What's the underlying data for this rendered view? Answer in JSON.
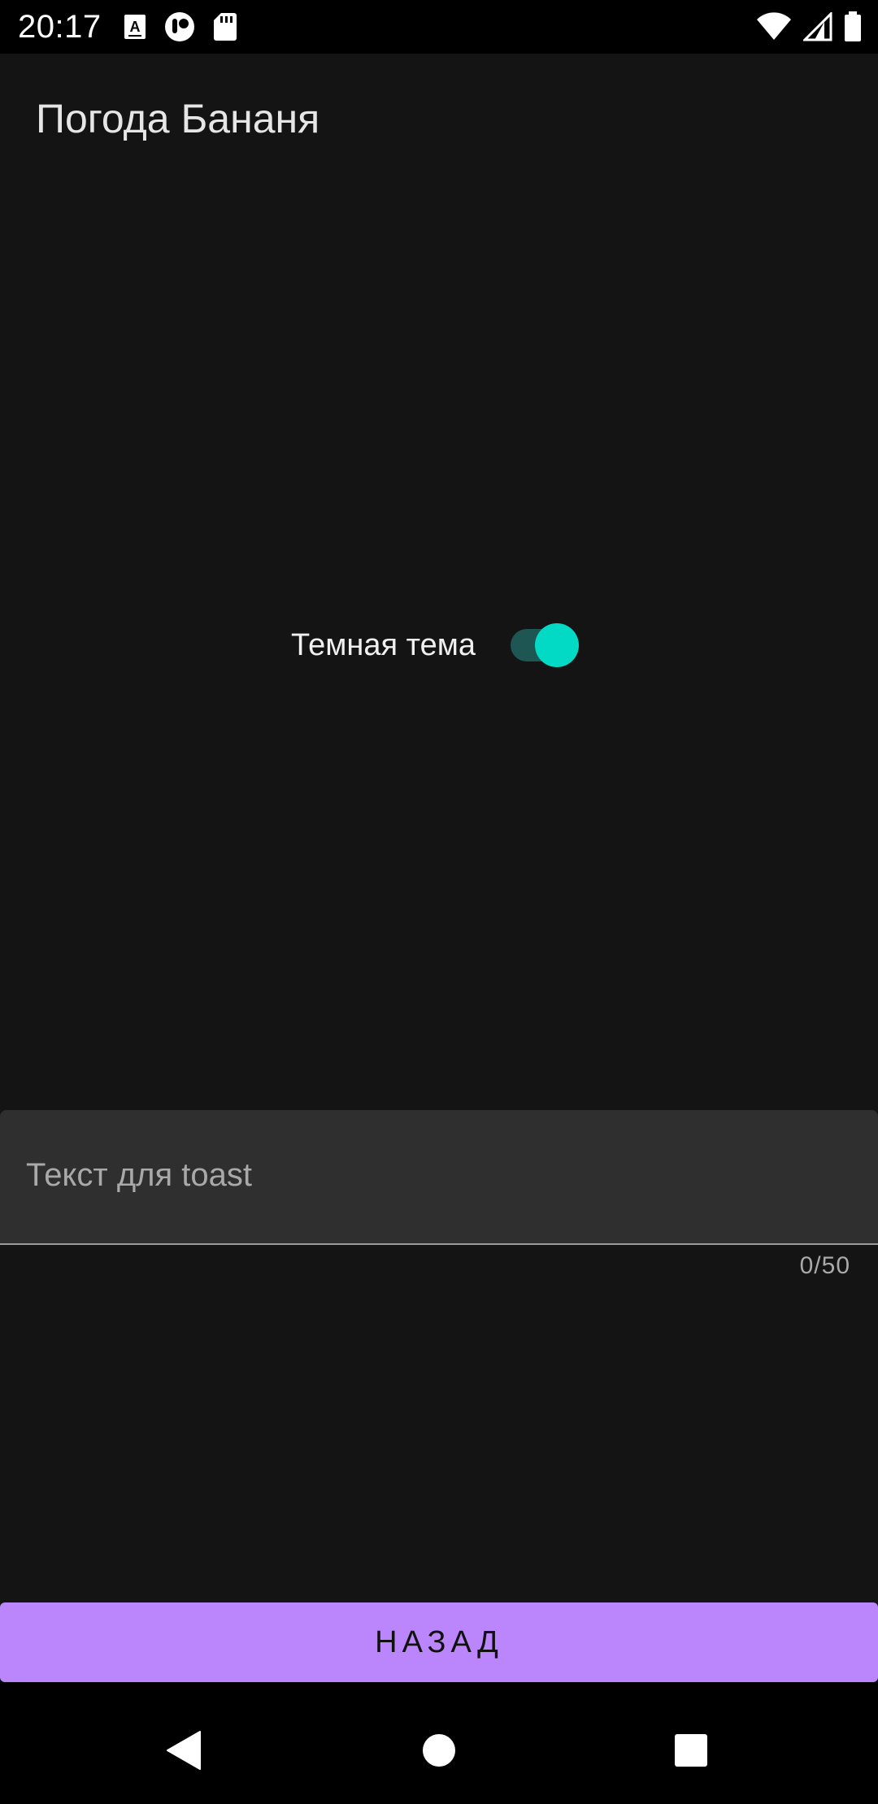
{
  "status_bar": {
    "time": "20:17",
    "left_icons": [
      "keyboard-a-icon",
      "notification-app-icon",
      "sd-card-icon"
    ],
    "right_icons": [
      "wifi-icon",
      "cell-signal-icon",
      "battery-icon"
    ]
  },
  "app": {
    "title": "Погода Бананя",
    "background_color": "#141414"
  },
  "theme_switch": {
    "label": "Темная тема",
    "checked": true,
    "track_color": "#1e5653",
    "thumb_color": "#03dac5"
  },
  "toast_input": {
    "placeholder": "Текст для toast",
    "value": "",
    "counter": "0/50"
  },
  "back_button": {
    "label": "НАЗАД",
    "color": "#bb86fc"
  },
  "nav_bar": {
    "icons": [
      "back-icon",
      "home-icon",
      "recents-icon"
    ]
  }
}
